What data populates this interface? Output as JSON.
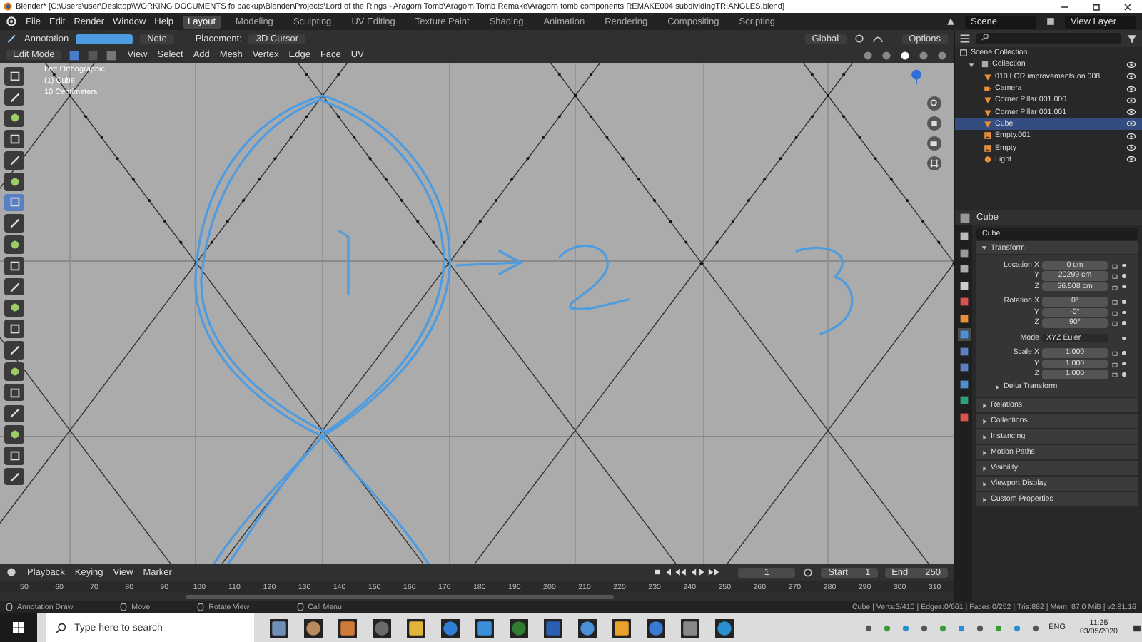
{
  "title_bar": {
    "title": "Blender* [C:\\Users\\user\\Desktop\\WORKING DOCUMENTS fo backup\\Blender\\Projects\\Lord of the Rings - Aragorn Tomb\\Aragorn Tomb Remake\\Aragorn tomb components REMAKE004 subdividingTRIANGLES.blend]"
  },
  "menu": [
    "File",
    "Edit",
    "Render",
    "Window",
    "Help"
  ],
  "workspaces": [
    {
      "label": "Layout",
      "selected": true
    },
    {
      "label": "Modeling",
      "selected": false
    },
    {
      "label": "Sculpting",
      "selected": false
    },
    {
      "label": "UV Editing",
      "selected": false
    },
    {
      "label": "Texture Paint",
      "selected": false
    },
    {
      "label": "Shading",
      "selected": false
    },
    {
      "label": "Animation",
      "selected": false
    },
    {
      "label": "Rendering",
      "selected": false
    },
    {
      "label": "Compositing",
      "selected": false
    },
    {
      "label": "Scripting",
      "selected": false
    }
  ],
  "scene": "Scene",
  "view_layer": "View Layer",
  "tool_header": {
    "tool": "Annotation",
    "note": "Note",
    "placement_label": "Placement:",
    "placement": "3D Cursor",
    "orientation": "Global",
    "options": "Options"
  },
  "viewport_header": {
    "mode": "Edit Mode",
    "menus": [
      "View",
      "Select",
      "Add",
      "Mesh",
      "Vertex",
      "Edge",
      "Face",
      "UV"
    ]
  },
  "viewport": {
    "view_name": "Left Orthographic",
    "object": "(1) Cube",
    "scale": "10 Centimeters"
  },
  "toolbar": [
    {
      "selected": false
    },
    {
      "selected": false
    },
    {
      "selected": false
    },
    {
      "selected": false
    },
    {
      "selected": false
    },
    {
      "selected": false
    },
    {
      "selected": true
    },
    {
      "selected": false
    },
    {
      "selected": false
    },
    {
      "selected": false
    },
    {
      "selected": false
    },
    {
      "selected": false
    },
    {
      "selected": false
    },
    {
      "selected": false
    },
    {
      "selected": false
    },
    {
      "selected": false
    },
    {
      "selected": false
    },
    {
      "selected": false
    },
    {
      "selected": false
    },
    {
      "selected": false
    }
  ],
  "outliner": {
    "root": "Scene Collection",
    "tree": [
      {
        "label": "Collection",
        "expanded": true,
        "children": [
          {
            "label": "010 LOR improvements on 008",
            "kind": "mesh",
            "selected": false
          },
          {
            "label": "Camera",
            "kind": "camera",
            "selected": false
          },
          {
            "label": "Corner Pillar 001.000",
            "kind": "mesh",
            "selected": false
          },
          {
            "label": "Corner Pillar 001.001",
            "kind": "mesh",
            "selected": false
          },
          {
            "label": "Cube",
            "kind": "mesh",
            "selected": true
          },
          {
            "label": "Empty.001",
            "kind": "empty",
            "selected": false
          },
          {
            "label": "Empty",
            "kind": "empty",
            "selected": false
          },
          {
            "label": "Light",
            "kind": "light",
            "selected": false
          }
        ]
      }
    ]
  },
  "properties": {
    "header": "Cube",
    "object_name": "Cube",
    "transform": {
      "title": "Transform",
      "expanded": true,
      "rows": [
        {
          "label": "Location X",
          "value": "0 cm",
          "kind": "field",
          "gap_before": false
        },
        {
          "label": "Y",
          "value": "20299 cm",
          "kind": "field",
          "gap_before": false
        },
        {
          "label": "Z",
          "value": "56.508 cm",
          "kind": "field",
          "gap_before": false
        },
        {
          "label": "Rotation X",
          "value": "0°",
          "kind": "field",
          "gap_before": true
        },
        {
          "label": "Y",
          "value": "-0°",
          "kind": "field",
          "gap_before": false
        },
        {
          "label": "Z",
          "value": "90°",
          "kind": "field",
          "gap_before": false
        },
        {
          "label": "Mode",
          "value": "XYZ Euler",
          "kind": "dropdown",
          "gap_before": true
        },
        {
          "label": "Scale X",
          "value": "1.000",
          "kind": "field",
          "gap_before": true
        },
        {
          "label": "Y",
          "value": "1.000",
          "kind": "field",
          "gap_before": false
        },
        {
          "label": "Z",
          "value": "1.000",
          "kind": "field",
          "gap_before": false
        }
      ],
      "subpanels": [
        "Delta Transform"
      ]
    },
    "panels": [
      "Relations",
      "Collections",
      "Instancing",
      "Motion Paths",
      "Visibility",
      "Viewport Display",
      "Custom Properties"
    ]
  },
  "timeline": {
    "menus": [
      "Playback",
      "Keying",
      "View",
      "Marker"
    ],
    "frame": "1",
    "start_label": "Start",
    "start": "1",
    "end_label": "End",
    "end": "250",
    "ticks": [
      "50",
      "60",
      "70",
      "80",
      "90",
      "100",
      "110",
      "120",
      "130",
      "140",
      "150",
      "160",
      "170",
      "180",
      "190",
      "200",
      "210",
      "220",
      "230",
      "240",
      "250",
      "260",
      "270",
      "280",
      "290",
      "300",
      "310"
    ]
  },
  "status_bar": {
    "hints": [
      "Annotation Draw",
      "Move",
      "Rotate View",
      "Call Menu"
    ],
    "stats": "Cube | Verts:3/410 | Edges:0/661 | Faces:0/252 | Tris:882 | Mem: 87.0 MiB | v2.81.16"
  },
  "taskbar": {
    "search_placeholder": "Type here to search",
    "language": "ENG",
    "time": "11:25",
    "date": "03/05/2020"
  }
}
